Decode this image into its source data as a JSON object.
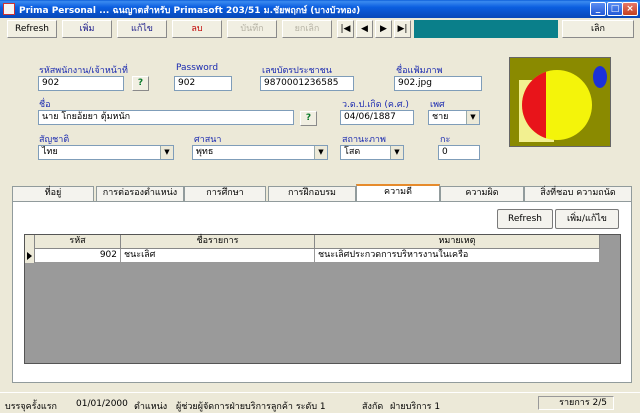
{
  "window": {
    "title": "Prima Personal ... ฉนญาตสำหรับ  Primasoft  203/51 ม.ชัยพฤกษ์ (บางบัวทอง)",
    "min": "_",
    "max": "□",
    "close": "×"
  },
  "toolbar": {
    "refresh": "Refresh",
    "add": "เพิ่ม",
    "edit": "แก้ไข",
    "delete": "ลบ",
    "save": "บันทึก",
    "cancel": "ยกเลิก",
    "first": "|◀",
    "prev": "◀",
    "next": "▶",
    "last": "▶|",
    "exit": "เลิก"
  },
  "form": {
    "emp_id_label": "รหัสพนักงาน/เจ้าหน้าที่",
    "emp_id": "902",
    "lookup": "?",
    "password_label": "Password",
    "password": "902",
    "citizen_id_label": "เลขบัตรประชาชน",
    "citizen_id": "9870001236585",
    "photo_file_label": "ชื่อแฟ้มภาพ",
    "photo_file": "902.jpg",
    "name_label": "ชื่อ",
    "name": "นาย โกยอ้ยยา ตุ้มหนัก",
    "birth_label": "ว.ด.ป.เกิด (ค.ศ.)",
    "birth": "04/06/1887",
    "sex_label": "เพศ",
    "sex": "ชาย",
    "nationality_label": "สัญชาติ",
    "nationality": "ไทย",
    "religion_label": "ศาสนา",
    "religion": "พุทธ",
    "status_label": "สถานะภาพ",
    "status": "โสด",
    "children_label": "กะ",
    "children": "0"
  },
  "tabs": [
    "ที่อยู่",
    "การต่อรองตำแหน่ง",
    "การศึกษา",
    "การฝึกอบรม",
    "ความดี",
    "ความผิด",
    "สิ่งที่ชอบ ความถนัด"
  ],
  "panel": {
    "refresh": "Refresh",
    "edit": "เพิ่ม/แก้ไข"
  },
  "grid": {
    "columns": [
      "รหัส",
      "ชื่อรายการ",
      "หมายเหตุ"
    ],
    "rows": [
      {
        "code": "902",
        "item": "ชนะเลิศ",
        "note": "ชนะเลิศประกวดการบริหารงานในเครือ"
      }
    ]
  },
  "statusbar": {
    "start_label": "บรรจุครั้งแรก",
    "start": "01/01/2000",
    "position_label": "ตำแหน่ง",
    "position": "ผู้ช่วยผู้จัดการฝ่ายบริการลูกค้า ระดับ 1",
    "dept_label": "สังกัด",
    "dept": "ฝ่ายบริการ 1",
    "record": "รายการ 2/5"
  }
}
